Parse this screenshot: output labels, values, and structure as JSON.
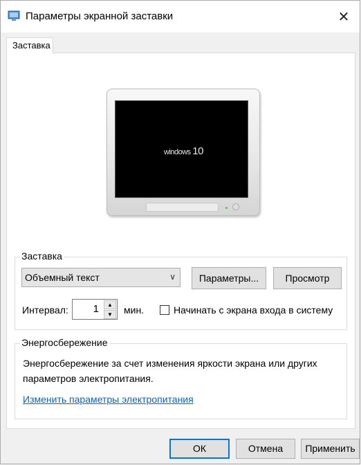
{
  "window": {
    "title": "Параметры экранной заставки",
    "icon": "screensaver-monitor-icon",
    "close_glyph": "✕"
  },
  "tabs": [
    {
      "label": "Заставка",
      "active": true
    }
  ],
  "preview": {
    "screen_text_small": "windows",
    "screen_text_big": "10"
  },
  "screensaver": {
    "group_label": "Заставка",
    "selected": "Объемный текст",
    "settings_button": "Параметры...",
    "preview_button": "Просмотр",
    "interval_label": "Интервал:",
    "interval_value": "1",
    "interval_unit": "мин.",
    "resume_checkbox_label": "Начинать с экрана входа в систему",
    "resume_checked": false
  },
  "power": {
    "group_label": "Энергосбережение",
    "description_line1": "Энергосбережение за счет изменения яркости экрана или других",
    "description_line2": "параметров электропитания.",
    "link": "Изменить параметры электропитания"
  },
  "footer": {
    "ok": "ОК",
    "cancel": "Отмена",
    "apply": "Применить"
  },
  "colors": {
    "accent": "#0078d7",
    "link": "#0066cc"
  }
}
